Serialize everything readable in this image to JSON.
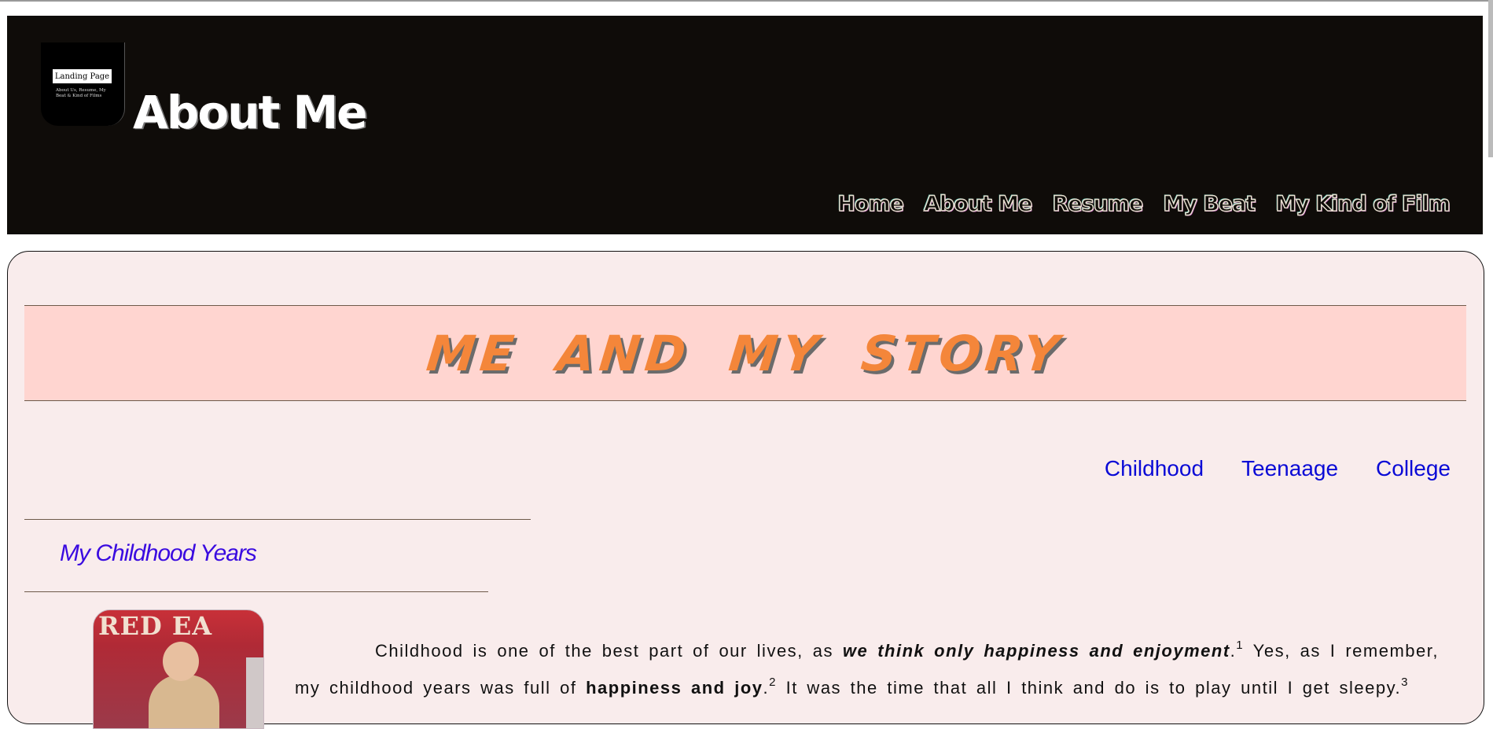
{
  "header": {
    "logo": {
      "tag": "Landing Page",
      "subtitle": "About Us, Resume, My Beat & Kind of Films"
    },
    "title": "About Me",
    "nav": [
      "Home",
      "About Me",
      "Resume",
      "My Beat",
      "My Kind of Film"
    ]
  },
  "main": {
    "banner_title": "ME AND MY STORY",
    "subnav": [
      "Childhood",
      "Teenaage",
      "College"
    ],
    "section_title": "My Childhood Years",
    "photo_text": "RED EA",
    "paragraph": {
      "p1": "Childhood is one of the best part of our lives, as ",
      "p1_bold_italic": "we think only happiness and enjoyment",
      "p1_end": ".",
      "sup1": "1",
      "p2": " Yes, as I remember, my childhood years was full of ",
      "p2_bold": "happiness and joy",
      "p2_end": ".",
      "sup2": "2",
      "p3": " It was the time that all I think and do is to play until I get sleepy.",
      "sup3": "3"
    }
  },
  "colors": {
    "header_bg": "#0f0c09",
    "card_bg": "#f9ecec",
    "banner_bg": "#ffd5d0",
    "banner_text": "#f4863a",
    "subnav_link": "#0a0ad6",
    "section_title": "#3a0be0"
  }
}
